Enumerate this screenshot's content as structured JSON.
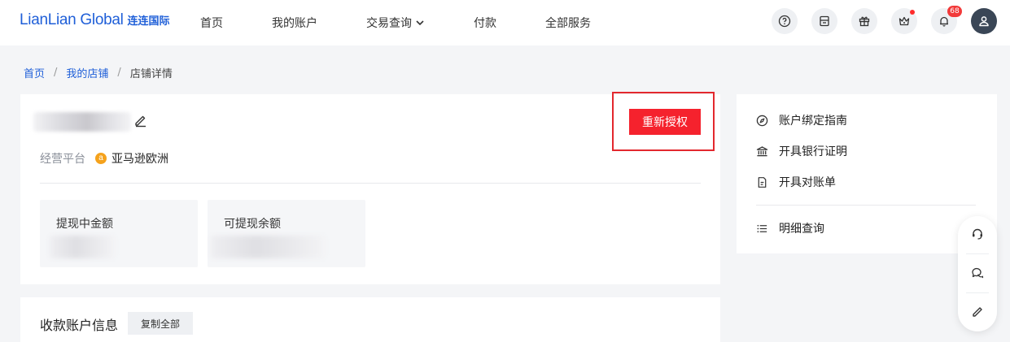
{
  "brand": {
    "logo_en": "LianLian Global",
    "logo_cn": "连连国际",
    "accent_color": "#1f5fd8"
  },
  "nav": {
    "items": [
      {
        "label": "首页"
      },
      {
        "label": "我的账户"
      },
      {
        "label": "交易查询",
        "has_dropdown": true
      },
      {
        "label": "付款"
      },
      {
        "label": "全部服务"
      }
    ]
  },
  "top_icons": {
    "help_icon": "question-circle-icon",
    "calendar_icon": "calendar-icon",
    "gift_icon": "gift-icon",
    "crown_icon": "crown-icon",
    "bell_icon": "bell-icon",
    "bell_badge": "68",
    "user_icon": "user-icon"
  },
  "breadcrumb": {
    "home": "首页",
    "stores": "我的店铺",
    "current": "店铺详情",
    "separator": "/"
  },
  "store": {
    "reauthorize_label": "重新授权",
    "platform_label": "经营平台",
    "platform_icon_letter": "a",
    "platform_value": "亚马逊欧洲",
    "withdrawing_label": "提现中金额",
    "available_label": "可提现余额"
  },
  "receiving": {
    "title": "收款账户信息",
    "copy_all_label": "复制全部"
  },
  "side_panel": {
    "items": [
      {
        "label": "账户绑定指南",
        "icon": "compass-icon"
      },
      {
        "label": "开具银行证明",
        "icon": "bank-icon"
      },
      {
        "label": "开具对账单",
        "icon": "document-icon"
      },
      {
        "label": "明细查询",
        "icon": "list-icon"
      }
    ]
  },
  "float_toolbar": {
    "items": [
      "headset-icon",
      "chat-icon",
      "pencil-icon"
    ]
  },
  "colors": {
    "primary_red": "#f5222d",
    "highlight_border": "#e3282e",
    "badge_red": "#f23a3a"
  }
}
